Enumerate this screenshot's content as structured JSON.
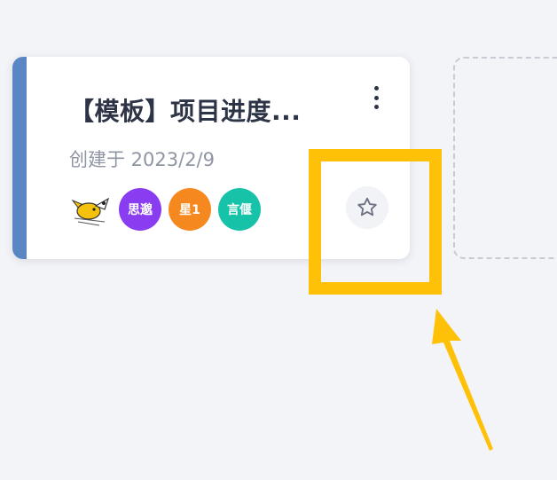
{
  "card": {
    "title": "【模板】项目进度...",
    "created": "创建于 2023/2/9",
    "accent_color": "#5a86c4",
    "members": [
      {
        "kind": "image",
        "icon": "cartoon-mouse-avatar"
      },
      {
        "label": "思邈",
        "color": "#8a3cf0"
      },
      {
        "label": "星1",
        "color": "#f5891f"
      },
      {
        "label": "言偃",
        "color": "#17c3a8"
      }
    ]
  },
  "icons": {
    "menu": "more-vertical-icon",
    "favorite": "star-outline-icon"
  },
  "annotation": {
    "highlight_color": "#ffc107"
  }
}
